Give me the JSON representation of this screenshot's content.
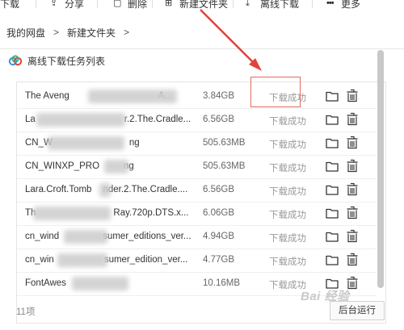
{
  "toolbar": {
    "items": [
      {
        "label": "下载",
        "icon": "download-icon"
      },
      {
        "label": "分享",
        "icon": "share-icon"
      },
      {
        "label": "删除",
        "icon": "trash-icon"
      },
      {
        "label": "新建文件夹",
        "icon": "new-folder-icon"
      },
      {
        "label": "离线下载",
        "icon": "offline-download-icon"
      },
      {
        "label": "更多",
        "icon": "more-icon"
      }
    ]
  },
  "breadcrumb": {
    "root": "我的网盘",
    "sep1": ">",
    "folder": "新建文件夹",
    "sep2": ">"
  },
  "dialog": {
    "title": "离线下载任务列表",
    "rows": [
      {
        "name": "The Aveng",
        "name_tail": "A...",
        "size": "3.84GB",
        "status": "下载成功"
      },
      {
        "name": "La",
        "name_tail": "r.2.The.Cradle....",
        "size": "6.56GB",
        "status": "下载成功"
      },
      {
        "name": "CN_W",
        "name_tail": "ng",
        "size": "505.63MB",
        "status": "下载成功"
      },
      {
        "name": "CN_WINXP_PRO",
        "name_tail": "ng",
        "size": "505.63MB",
        "status": "下载成功"
      },
      {
        "name": "Lara.Croft.Tomb",
        "name_tail": "nder.2.The.Cradle....",
        "size": "6.56GB",
        "status": "下载成功"
      },
      {
        "name": "Th",
        "name_tail": "Ray.720p.DTS.x...",
        "size": "6.06GB",
        "status": "下载成功"
      },
      {
        "name": "cn_wind",
        "name_tail": "sumer_editions_ver...",
        "size": "4.94GB",
        "status": "下载成功"
      },
      {
        "name": "cn_win",
        "name_tail": "sumer_edition_ver...",
        "size": "4.77GB",
        "status": "下载成功"
      },
      {
        "name": "FontAwes",
        "name_tail": "",
        "size": "10.16MB",
        "status": "下载成功"
      }
    ],
    "count": "11项",
    "background_button": "后台运行"
  },
  "watermark": "Bai 经验",
  "colors": {
    "highlight": "#e36a5b",
    "arrow": "#e0433a",
    "status_text": "#999999"
  }
}
